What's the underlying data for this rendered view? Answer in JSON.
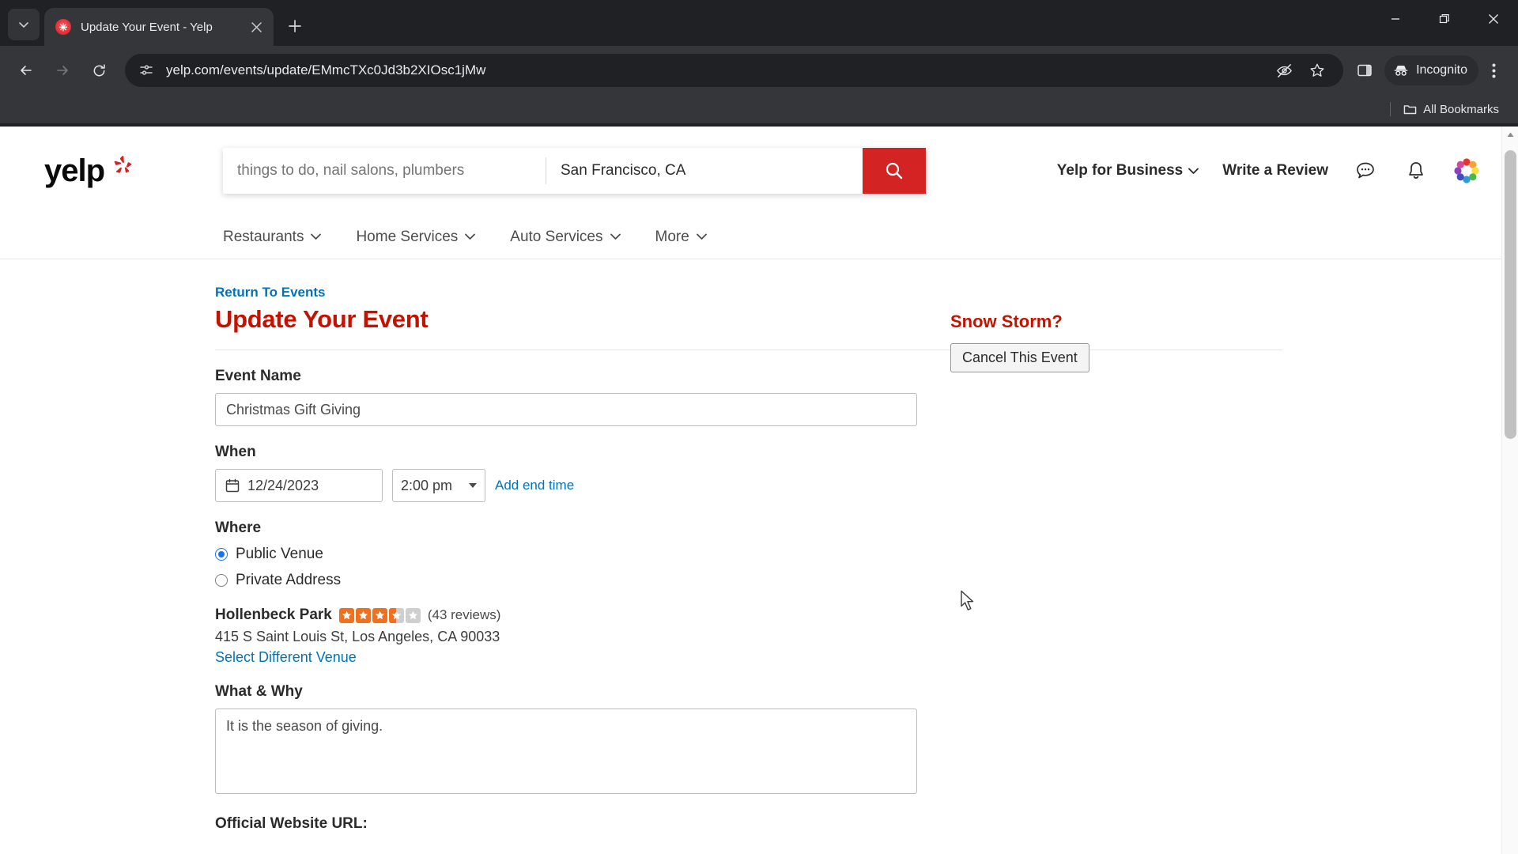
{
  "browser": {
    "tab": {
      "title": "Update Your Event - Yelp",
      "favicon": "yelp-favicon"
    },
    "new_tab_label": "+",
    "window_controls": {
      "minimize": "minimize-icon",
      "maximize": "restore-icon",
      "close": "close-icon"
    },
    "toolbar": {
      "back": "back-arrow-icon",
      "forward": "forward-arrow-icon",
      "reload": "reload-icon",
      "site_info": "site-settings-icon",
      "url": "yelp.com/events/update/EMmcTXc0Jd3b2XIOsc1jMw",
      "tracking_protection": "eye-slash-icon",
      "bookmark": "star-icon",
      "side_panel": "side-panel-icon",
      "profile_label": "Incognito",
      "menu": "three-dot-menu-icon"
    },
    "bookmarks_bar": {
      "all_bookmarks_label": "All Bookmarks",
      "folder_icon": "folder-icon"
    }
  },
  "yelp": {
    "logo_text": "yelp",
    "search": {
      "term_placeholder": "things to do, nail salons, plumbers",
      "term_value": "",
      "location_value": "San Francisco, CA",
      "location_placeholder": "San Francisco, CA",
      "button_icon": "search-icon",
      "button_color": "#d32323"
    },
    "nav": {
      "business_label": "Yelp for Business",
      "write_review_label": "Write a Review",
      "messages_icon": "message-bubble-icon",
      "notifications_icon": "bell-icon",
      "avatar_icon": "user-avatar"
    },
    "categories": [
      {
        "label": "Restaurants"
      },
      {
        "label": "Home Services"
      },
      {
        "label": "Auto Services"
      },
      {
        "label": "More"
      }
    ]
  },
  "page": {
    "return_link": "Return To Events",
    "title": "Update Your Event",
    "title_color": "#c41200",
    "event_name": {
      "label": "Event Name",
      "value": "Christmas Gift Giving"
    },
    "when": {
      "label": "When",
      "date_value": "12/24/2023",
      "time_value": "2:00 pm",
      "add_end_time_label": "Add end time"
    },
    "where": {
      "label": "Where",
      "options": [
        {
          "label": "Public Venue",
          "selected": true
        },
        {
          "label": "Private Address",
          "selected": false
        }
      ]
    },
    "venue": {
      "name": "Hollenbeck Park",
      "rating": 3.5,
      "reviews_text": "(43 reviews)",
      "address": "415 S Saint Louis St, Los Angeles, CA 90033",
      "change_link": "Select Different Venue"
    },
    "what_why": {
      "label": "What & Why",
      "value": "It is the season of giving."
    },
    "website": {
      "label": "Official Website URL:"
    },
    "sidebar": {
      "title": "Snow Storm?",
      "cancel_button_label": "Cancel This Event"
    }
  }
}
